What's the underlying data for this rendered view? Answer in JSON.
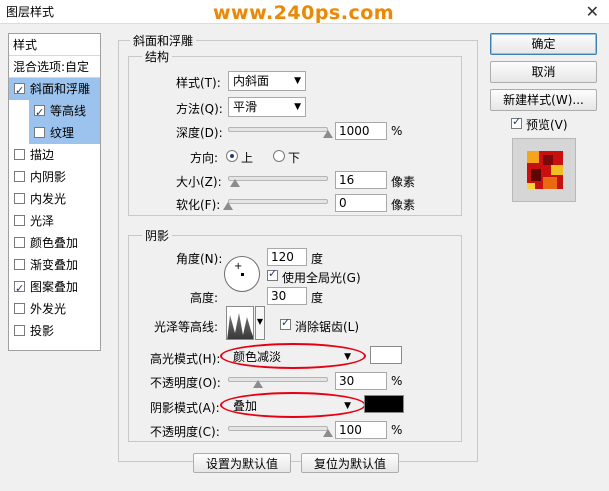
{
  "window": {
    "title": "图层样式",
    "close_glyph": "✕"
  },
  "watermark": "www.240ps.com",
  "styles_list": {
    "header": "样式",
    "blend_options": "混合选项:自定",
    "items": [
      {
        "label": "斜面和浮雕",
        "checked": true
      },
      {
        "label": "等高线",
        "checked": true
      },
      {
        "label": "纹理",
        "checked": false
      },
      {
        "label": "描边",
        "checked": false
      },
      {
        "label": "内阴影",
        "checked": false
      },
      {
        "label": "内发光",
        "checked": false
      },
      {
        "label": "光泽",
        "checked": false
      },
      {
        "label": "颜色叠加",
        "checked": false
      },
      {
        "label": "渐变叠加",
        "checked": false
      },
      {
        "label": "图案叠加",
        "checked": true
      },
      {
        "label": "外发光",
        "checked": false
      },
      {
        "label": "投影",
        "checked": false
      }
    ]
  },
  "bevel": {
    "group_title": "斜面和浮雕",
    "structure": {
      "title": "结构",
      "style_label": "样式(T):",
      "style_value": "内斜面",
      "technique_label": "方法(Q):",
      "technique_value": "平滑",
      "depth_label": "深度(D):",
      "depth_value": "1000",
      "depth_unit": "%",
      "depth_level": 1.0,
      "direction_label": "方向:",
      "dir_up": "上",
      "dir_down": "下",
      "direction": "up",
      "size_label": "大小(Z):",
      "size_value": "16",
      "size_unit": "像素",
      "size_level": 0.07,
      "soften_label": "软化(F):",
      "soften_value": "0",
      "soften_unit": "像素",
      "soften_level": 0.0
    },
    "shading": {
      "title": "阴影",
      "angle_label": "角度(N):",
      "angle_value": "120",
      "angle_unit": "度",
      "global_light_label": "使用全局光(G)",
      "global_light": true,
      "altitude_label": "高度:",
      "altitude_value": "30",
      "altitude_unit": "度",
      "gloss_label": "光泽等高线:",
      "antialias_label": "消除锯齿(L)",
      "antialias": true,
      "highlight_mode_label": "高光模式(H):",
      "highlight_mode_value": "颜色减淡",
      "highlight_color": "#ffffff",
      "highlight_opacity_label": "不透明度(O):",
      "highlight_opacity_value": "30",
      "highlight_opacity_unit": "%",
      "highlight_opacity_level": 0.3,
      "shadow_mode_label": "阴影模式(A):",
      "shadow_mode_value": "叠加",
      "shadow_color": "#000000",
      "shadow_opacity_label": "不透明度(C):",
      "shadow_opacity_value": "100",
      "shadow_opacity_unit": "%",
      "shadow_opacity_level": 1.0
    },
    "set_default_button": "设置为默认值",
    "reset_default_button": "复位为默认值"
  },
  "right": {
    "ok_button": "确定",
    "cancel_button": "取消",
    "new_style_button": "新建样式(W)...",
    "preview_label": "预览(V)",
    "preview_checked": true
  },
  "colors": {
    "selection": "#9cc3ee",
    "highlight_oval": "#e60012",
    "watermark": "#e8890b"
  }
}
